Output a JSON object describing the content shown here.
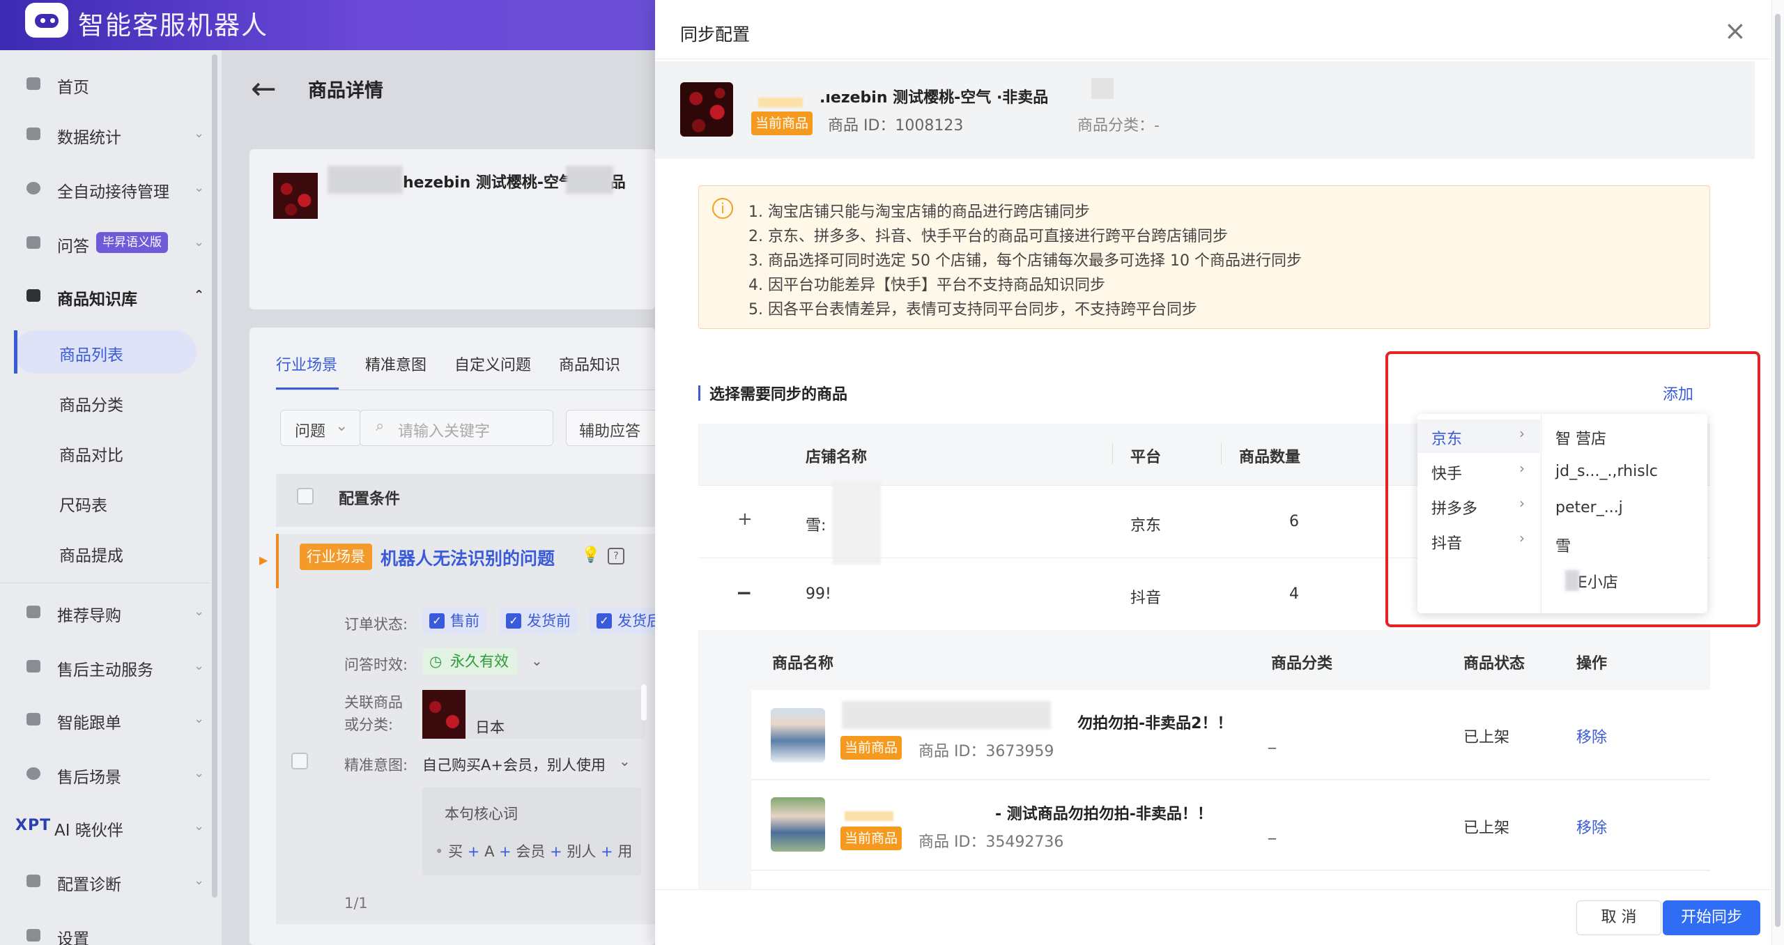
{
  "app": {
    "title": "智能客服机器人"
  },
  "sidebar": {
    "items": [
      {
        "label": "首页"
      },
      {
        "label": "数据统计"
      },
      {
        "label": "全自动接待管理"
      },
      {
        "label": "问答",
        "badge": "毕昇语义版"
      },
      {
        "label": "商品知识库"
      },
      {
        "label": "推荐导购"
      },
      {
        "label": "售后主动服务"
      },
      {
        "label": "智能跟单"
      },
      {
        "label": "售后场景"
      },
      {
        "label": "AI 晓伙伴",
        "prefix": "XPT"
      },
      {
        "label": "配置诊断"
      },
      {
        "label": "设置"
      }
    ],
    "sub_items": [
      {
        "label": "商品列表"
      },
      {
        "label": "商品分类"
      },
      {
        "label": "商品对比"
      },
      {
        "label": "尺码表"
      },
      {
        "label": "商品提成"
      }
    ]
  },
  "detail": {
    "title": "商品详情",
    "product_name": "hezebin 测试樱桃-空气          非卖品",
    "tabs": [
      "行业场景",
      "精准意图",
      "自定义问题",
      "商品知识"
    ],
    "filter_select": "问题",
    "search_placeholder": "请输入关键字",
    "assist_button": "辅助应答",
    "table_header": "配置条件",
    "scene_tag": "行业场景",
    "scene_title": "机器人无法识别的问题",
    "order_status_label": "订单状态:",
    "order_status_tags": [
      "售前",
      "发货前",
      "发货后"
    ],
    "validity_label": "问答时效:",
    "validity_value": "永久有效",
    "related_label": "关联商品\n或分类:",
    "related_value": "日本",
    "intent_label": "精准意图:",
    "intent_value": "自己购买A+会员，别人使用",
    "core_words_title": "本句核心词",
    "core_words": [
      "买",
      "A",
      "会员",
      "别人",
      "用"
    ],
    "pager": "1/1"
  },
  "dialog": {
    "title": "同步配置",
    "current_product": {
      "name": ".ıezebin 测试樱桃-空气        ·非卖品",
      "tag": "当前商品",
      "id_text": "商品 ID：1008123",
      "category_text": "商品分类：-"
    },
    "notices": [
      "1. 淘宝店铺只能与淘宝店铺的商品进行跨店铺同步",
      "2. 京东、拼多多、抖音、快手平台的商品可直接进行跨平台跨店铺同步",
      "3. 商品选择可同时选定 50 个店铺，每个店铺每次最多可选择 10 个商品进行同步",
      "4. 因平台功能差异【快手】平台不支持商品知识同步",
      "5. 因各平台表情差异，表情可支持同平台同步，不支持跨平台同步"
    ],
    "section_title": "选择需要同步的商品",
    "add_label": "添加",
    "store_table": {
      "headers": [
        "店铺名称",
        "平台",
        "商品数量"
      ],
      "rows": [
        {
          "expand": "+",
          "store": "雪:",
          "platform": "京东",
          "count": "6"
        },
        {
          "expand": "−",
          "store": "99!",
          "platform": "抖音",
          "count": "4"
        }
      ]
    },
    "product_table": {
      "headers": [
        "商品名称",
        "商品分类",
        "商品状态",
        "操作"
      ],
      "rows": [
        {
          "name": "勿拍勿拍-非卖品2！！",
          "tag": "当前商品",
          "id_text": "商品 ID：3673959",
          "category": "_",
          "status": "已上架",
          "action": "移除"
        },
        {
          "name": "- 测试商品勿拍勿拍-非卖品！！",
          "tag": "当前商品",
          "id_text": "商品 ID：35492736",
          "category": "_",
          "status": "已上架",
          "action": "移除"
        }
      ]
    },
    "cancel_label": "取 消",
    "sync_label": "开始同步"
  },
  "cascader": {
    "platforms": [
      "京东",
      "快手",
      "拼多多",
      "抖音"
    ],
    "stores": [
      "智               营店",
      "jd_s..._.,rhislc",
      "peter_...j",
      "雪",
      "E小店"
    ]
  },
  "colors": {
    "primary": "#3a5bd9",
    "orange": "#f59a1f",
    "highlight_border": "#e62229",
    "header_gradient": "#4a33c0"
  }
}
